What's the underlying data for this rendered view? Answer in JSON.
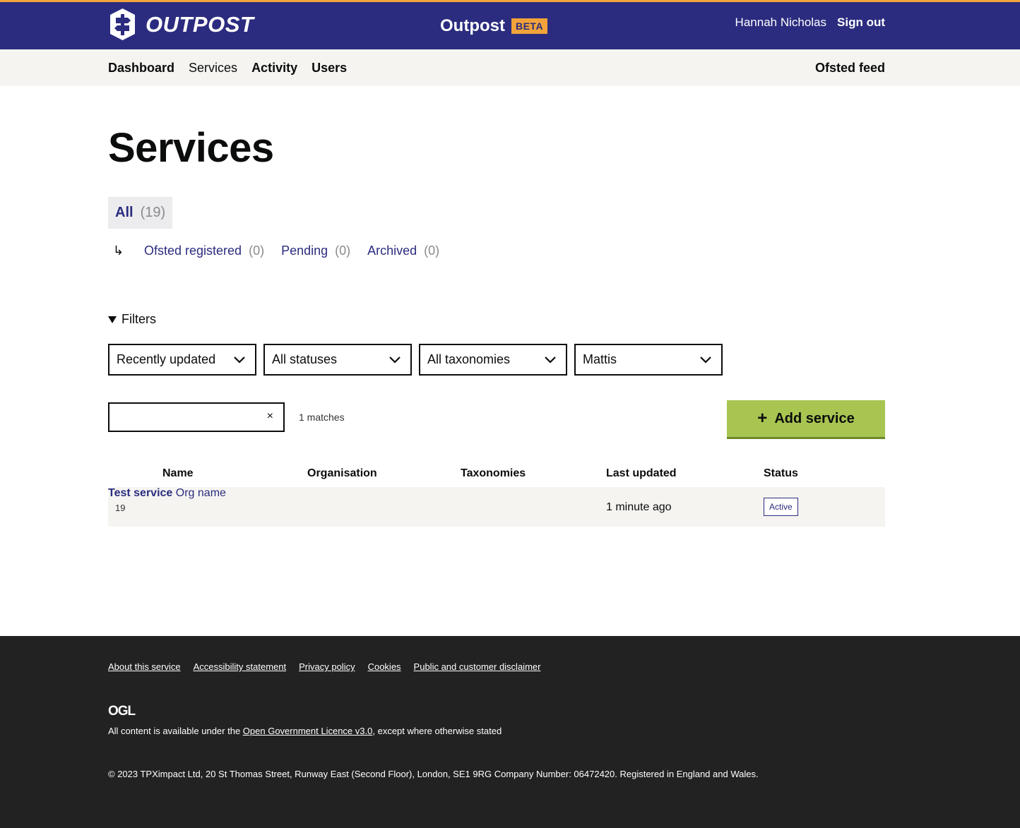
{
  "header": {
    "logo_text": "OUTPOST",
    "app_name": "Outpost",
    "badge": "BETA",
    "user_name": "Hannah Nicholas",
    "sign_out": "Sign out",
    "colors": {
      "brand": "#2b2c7f",
      "accent": "#f2a33a"
    }
  },
  "nav": {
    "items": [
      {
        "label": "Dashboard"
      },
      {
        "label": "Services"
      },
      {
        "label": "Activity"
      },
      {
        "label": "Users"
      }
    ],
    "right": "Ofsted feed"
  },
  "page": {
    "title": "Services"
  },
  "tabs": {
    "all": {
      "label": "All",
      "count": "(19)"
    },
    "arrow": "↳",
    "sub": [
      {
        "label": "Ofsted registered",
        "count": "(0)"
      },
      {
        "label": "Pending",
        "count": "(0)"
      },
      {
        "label": "Archived",
        "count": "(0)"
      }
    ]
  },
  "filters": {
    "toggle_label": "Filters",
    "selects": [
      {
        "value": "Recently updated"
      },
      {
        "value": "All statuses"
      },
      {
        "value": "All taxonomies"
      },
      {
        "value": "Mattis"
      }
    ]
  },
  "search": {
    "value": "",
    "clear": "×",
    "matches": "1 matches"
  },
  "add_service": {
    "icon": "+",
    "label": "Add service",
    "color": "#a8c551"
  },
  "table": {
    "headers": {
      "name": "Name",
      "organisation": "Organisation",
      "taxonomies": "Taxonomies",
      "last_updated": "Last updated",
      "status": "Status"
    },
    "rows": [
      {
        "num": "19",
        "name": "Test service",
        "organisation": "Org name",
        "taxonomies": "",
        "last_updated": "1 minute ago",
        "status": "Active"
      }
    ]
  },
  "footer": {
    "links": [
      {
        "label": "About this service"
      },
      {
        "label": "Accessibility statement"
      },
      {
        "label": "Privacy policy"
      },
      {
        "label": "Cookies"
      },
      {
        "label": "Public and customer disclaimer"
      }
    ],
    "ogl": "OGL",
    "licence_pre": "All content is available under the ",
    "licence_link": "Open Government Licence v3.0",
    "licence_post": ", except where otherwise stated",
    "copyright": "© 2023 TPXimpact Ltd, 20 St Thomas Street, Runway East (Second Floor), London, SE1 9RG Company Number: 06472420. Registered in England and Wales."
  }
}
